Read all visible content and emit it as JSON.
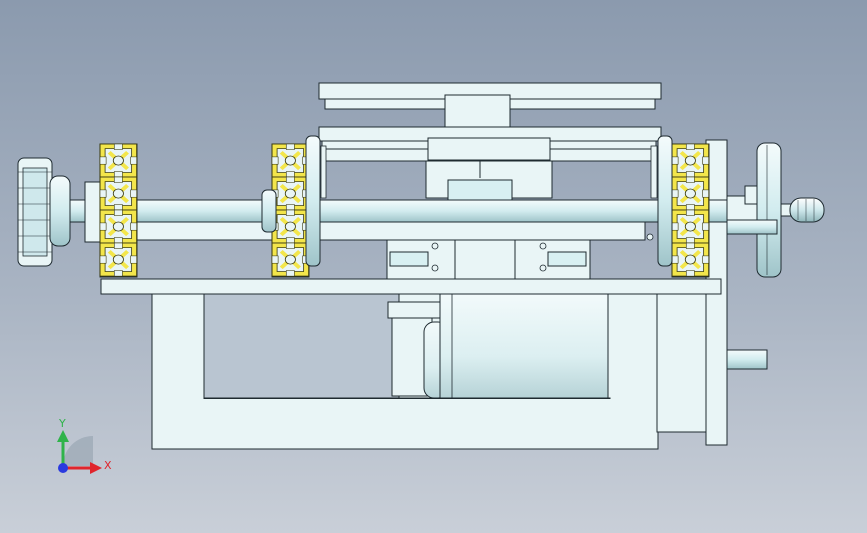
{
  "view": {
    "kind": "cad-assembly-front-view",
    "background_top": "#8b9aae",
    "background_bottom": "#c9cfd8"
  },
  "colors": {
    "part_fill": "#e9f5f6",
    "part_fill_cyan": "#d8f0f2",
    "part_stroke": "#1e2a30",
    "profile_yellow": "#f3e64b",
    "profile_stroke": "#3a3a10"
  },
  "triad": {
    "x_label": "X",
    "y_label": "Y",
    "x_color": "#e0242c",
    "y_color": "#2fb34a",
    "z_color": "#2a3adf"
  }
}
